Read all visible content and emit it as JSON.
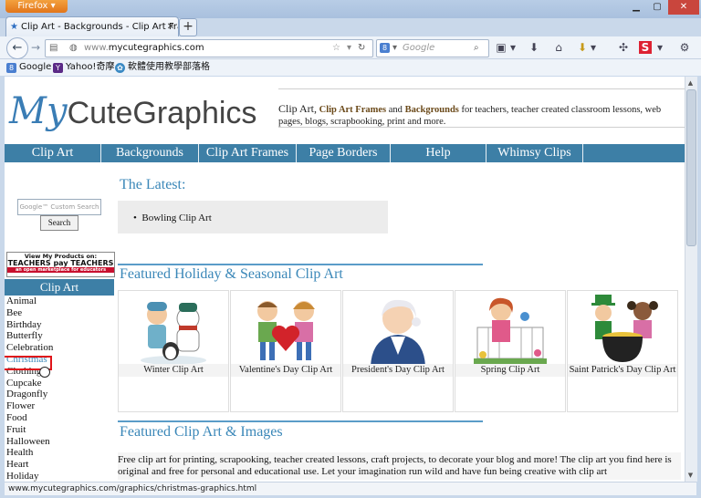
{
  "browser": {
    "app_button": "Firefox",
    "tab_title": "Clip Art - Backgrounds - Clip Art Fram...",
    "url_prefix": "www.",
    "url_domain": "mycutegraphics.com",
    "search_placeholder": "Google",
    "bookmarks": [
      "Google",
      "Yahoo!奇摩",
      "軟體使用教學部落格"
    ],
    "status_url": "www.mycutegraphics.com/graphics/christmas-graphics.html"
  },
  "site": {
    "logo_my": "My",
    "logo_rest": "CuteGraphics",
    "tagline": {
      "t1": "Clip Art,",
      "k1": "Clip Art Frames",
      "t2": "and",
      "k2": "Backgrounds",
      "t3": "for teachers, teacher created classroom lessons, web pages, blogs, scrapbooking, print and more."
    },
    "menu": [
      "Clip Art",
      "Backgrounds",
      "Clip Art Frames",
      "Page Borders",
      "Help",
      "Whimsy Clips"
    ],
    "search_placeholder": "Google™ Custom Search",
    "search_button": "Search",
    "tpt": {
      "line1": "View My Products on:",
      "line2": "TEACHERS pay TEACHERS",
      "line3": "an open marketplace for educators"
    },
    "sidebar_heading": "Clip Art",
    "sidebar_items": [
      "Animal",
      "Bee",
      "Birthday",
      "Butterfly",
      "Celebration",
      "Christmas",
      "Clothing",
      "Cupcake",
      "Dragonfly",
      "Flower",
      "Food",
      "Fruit",
      "Halloween",
      "Health",
      "Heart",
      "Holiday"
    ],
    "latest_title": "The Latest:",
    "latest_items": [
      "Bowling Clip Art"
    ],
    "featured_holiday_title": "Featured Holiday & Seasonal Clip Art",
    "cards": [
      "Winter Clip Art",
      "Valentine's Day Clip Art",
      "President's Day Clip Art",
      "Spring Clip Art",
      "Saint Patrick's Day Clip Art"
    ],
    "featured_images_title": "Featured Clip Art & Images",
    "paragraph": "Free clip art for printing, scrapooking, teacher created lessons, craft projects, to decorate your blog and more! The clip art you find here is original and free for personal and educational use. Let your imagination run wild and have fun being creative with clip art"
  },
  "colors": {
    "nav_blue": "#3d7fa6",
    "heading_blue": "#3a87b8",
    "highlight_red": "#e0151a"
  }
}
